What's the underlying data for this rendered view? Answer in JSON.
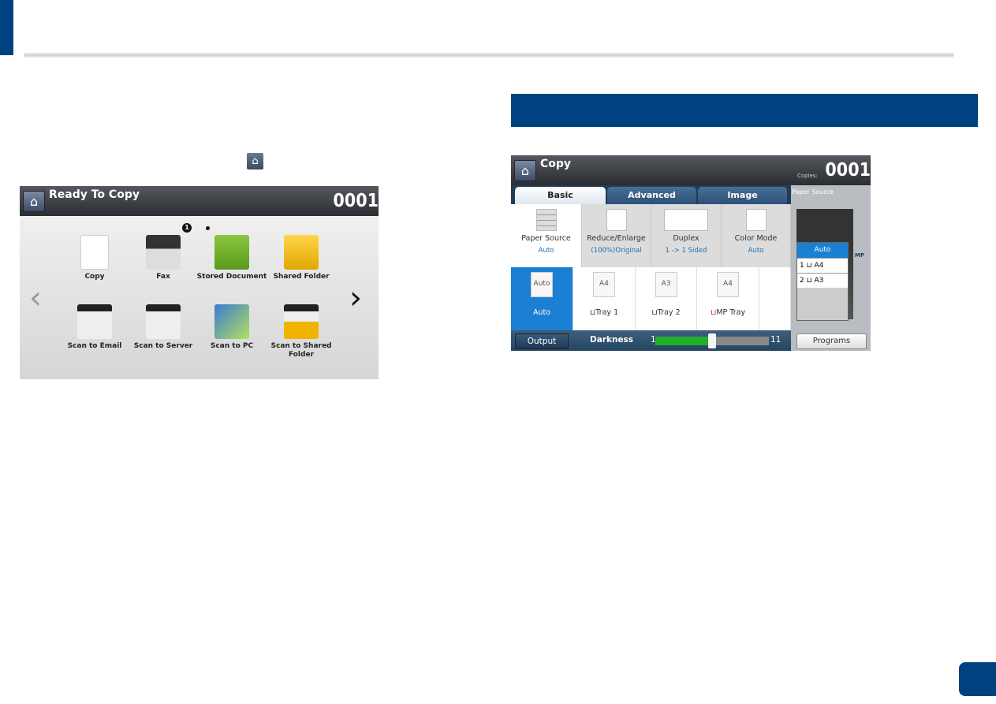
{
  "colors": {
    "brand": "#00427f",
    "accent_blue": "#1b7fd4",
    "slider_green": "#22b02b"
  },
  "left_screen": {
    "title": "Ready To Copy",
    "counter": "0001",
    "page_indicator": "1",
    "apps": [
      {
        "label": "Copy",
        "icon": "copy-icon"
      },
      {
        "label": "Fax",
        "icon": "fax-icon"
      },
      {
        "label": "Stored Document",
        "icon": "stored-document-icon"
      },
      {
        "label": "Shared Folder",
        "icon": "shared-folder-icon"
      },
      {
        "label": "Scan to Email",
        "icon": "scan-email-icon"
      },
      {
        "label": "Scan to Server",
        "icon": "scan-server-icon"
      },
      {
        "label": "Scan to PC",
        "icon": "scan-pc-icon"
      },
      {
        "label": "Scan to Shared Folder",
        "icon": "scan-shared-folder-icon"
      }
    ],
    "prev": "‹",
    "next": "›"
  },
  "right_screen": {
    "title": "Copy",
    "copies_label": "Copies:",
    "counter": "0001",
    "tabs": [
      "Basic",
      "Advanced",
      "Image"
    ],
    "active_tab": "Basic",
    "options": [
      {
        "label": "Paper Source",
        "value": "Auto"
      },
      {
        "label": "Reduce/Enlarge",
        "value": "(100%)Original"
      },
      {
        "label": "Duplex",
        "value": "1 -> 1 Sided"
      },
      {
        "label": "Color Mode",
        "value": "Auto"
      }
    ],
    "trays": [
      {
        "label": "Auto",
        "thumb": "Auto",
        "selected": true
      },
      {
        "label": "Tray 1",
        "thumb": "A4"
      },
      {
        "label": "Tray 2",
        "thumb": "A3"
      },
      {
        "label": "MP Tray",
        "thumb": "A4"
      }
    ],
    "side_panel": {
      "title": "Paper Source",
      "list": [
        "Auto",
        "1 ⊔ A4",
        "2 ⊔ A3"
      ],
      "mp_label": "MP"
    },
    "output_label": "Output",
    "darkness_label": "Darkness",
    "darkness_min": "1",
    "darkness_max": "11",
    "darkness_value": 6,
    "programs_label": "Programs"
  }
}
